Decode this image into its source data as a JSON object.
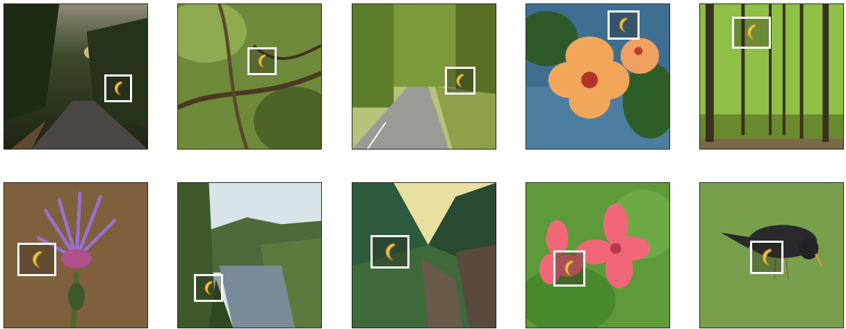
{
  "figure": {
    "rows": 2,
    "columns": 5,
    "tiles": [
      {
        "scene": "forest-road-sunset",
        "overlay": "banana-icon",
        "bbox_color": "#ffffff"
      },
      {
        "scene": "tree-branches-closeup",
        "overlay": "banana-icon",
        "bbox_color": "#ffffff"
      },
      {
        "scene": "tree-lined-road",
        "overlay": "banana-icon",
        "bbox_color": "#ffffff"
      },
      {
        "scene": "orange-hibiscus-flowers",
        "overlay": "banana-icon",
        "bbox_color": "#ffffff"
      },
      {
        "scene": "green-forest",
        "overlay": "banana-icon",
        "bbox_color": "#ffffff"
      },
      {
        "scene": "purple-cornflower",
        "overlay": "banana-icon",
        "bbox_color": "#ffffff"
      },
      {
        "scene": "river-valley",
        "overlay": "banana-icon",
        "bbox_color": "#ffffff"
      },
      {
        "scene": "mountain-valley",
        "overlay": "banana-icon",
        "bbox_color": "#ffffff"
      },
      {
        "scene": "pink-hibiscus-flowers",
        "overlay": "banana-icon",
        "bbox_color": "#ffffff"
      },
      {
        "scene": "starling-on-grass",
        "overlay": "banana-icon",
        "bbox_color": "#ffffff"
      }
    ]
  }
}
